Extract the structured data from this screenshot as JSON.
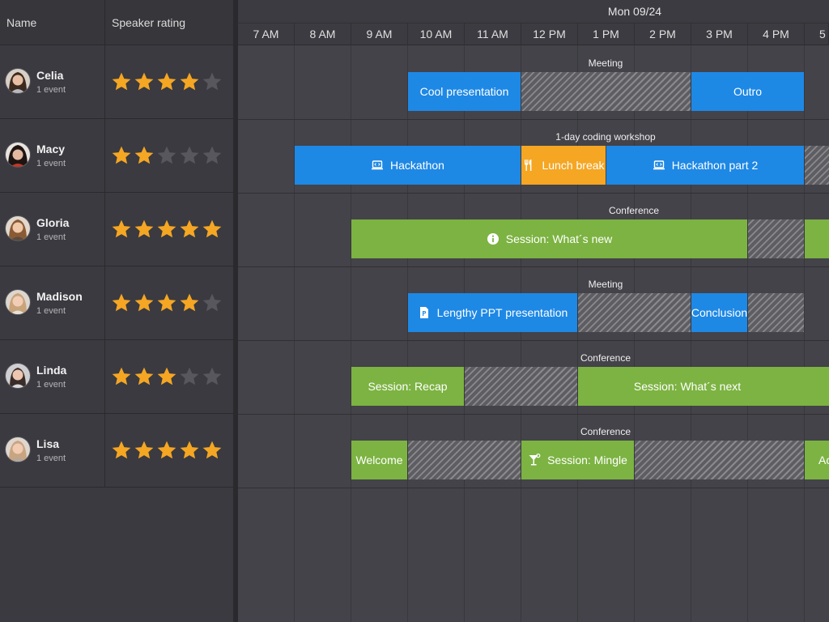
{
  "columns": {
    "name": "Name",
    "rating": "Speaker rating"
  },
  "date": "Mon 09/24",
  "hours": [
    "7 AM",
    "8 AM",
    "9 AM",
    "10 AM",
    "11 AM",
    "12 PM",
    "1 PM",
    "2 PM",
    "3 PM",
    "4 PM",
    "5"
  ],
  "colors": {
    "blue": "#1e88e5",
    "orange": "#f5a623",
    "green": "#7cb342",
    "star_on": "#f5a623",
    "star_off": "#57575d"
  },
  "rows": [
    {
      "name": "Celia",
      "events": "1 event",
      "rating": 4,
      "group": "Meeting"
    },
    {
      "name": "Macy",
      "events": "1 event",
      "rating": 2,
      "group": "1-day coding workshop"
    },
    {
      "name": "Gloria",
      "events": "1 event",
      "rating": 5,
      "group": "Conference"
    },
    {
      "name": "Madison",
      "events": "1 event",
      "rating": 4,
      "group": "Meeting"
    },
    {
      "name": "Linda",
      "events": "1 event",
      "rating": 3,
      "group": "Conference"
    },
    {
      "name": "Lisa",
      "events": "1 event",
      "rating": 5,
      "group": "Conference"
    }
  ],
  "events": {
    "celia_1": {
      "label": "Cool presentation",
      "start": "10 AM",
      "end": "12 PM"
    },
    "celia_2": {
      "label": "Outro",
      "start": "3 PM",
      "end": "5 PM"
    },
    "macy_1": {
      "label": "Hackathon",
      "start": "8 AM",
      "end": "12 PM",
      "icon": "laptop-code-icon"
    },
    "macy_2": {
      "label": "Lunch break",
      "start": "12 PM",
      "end": "1:30 PM",
      "icon": "utensils-icon"
    },
    "macy_3": {
      "label": "Hackathon part 2",
      "start": "1:30 PM",
      "end": "5 PM",
      "icon": "laptop-code-icon"
    },
    "gloria_1": {
      "label": "Session: What´s new",
      "start": "9 AM",
      "end": "4 PM",
      "icon": "info-circle-icon"
    },
    "madison_1": {
      "label": "Lengthy PPT presentation",
      "start": "10 AM",
      "end": "1 PM",
      "icon": "powerpoint-file-icon"
    },
    "madison_2": {
      "label": "Conclusion",
      "start": "3 PM",
      "end": "4 PM"
    },
    "linda_1": {
      "label": "Session: Recap",
      "start": "9 AM",
      "end": "11 AM"
    },
    "linda_2": {
      "label": "Session: What´s next",
      "start": "1 PM",
      "end": "5 PM"
    },
    "lisa_1": {
      "label": "Welcome",
      "start": "9 AM",
      "end": "10 AM"
    },
    "lisa_2": {
      "label": "Session: Mingle",
      "start": "12 PM",
      "end": "2 PM",
      "icon": "cocktail-icon"
    },
    "lisa_3": {
      "label": "Ac",
      "start": "5 PM",
      "end": ""
    }
  }
}
